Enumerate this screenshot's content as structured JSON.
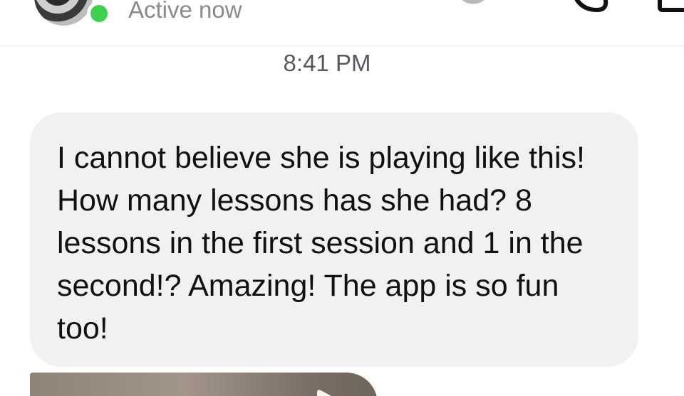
{
  "header": {
    "status": "Active now",
    "icons": [
      "avatar",
      "presence-dot",
      "phone-icon",
      "video-camera-icon",
      "info-icon"
    ]
  },
  "conversation": {
    "timestamp": "8:41 PM",
    "messages": [
      {
        "text": "I cannot believe she is playing like this! How many lessons has she had? 8 lessons in the first session and 1 in the second!? Amazing! The app is so fun too!"
      }
    ],
    "attachments": [
      {
        "type": "video",
        "icon": "play-icon"
      }
    ]
  },
  "colors": {
    "presence": "#3ecf50",
    "bubble": "#f1f1f3",
    "muted_text": "#8a8a8e"
  }
}
